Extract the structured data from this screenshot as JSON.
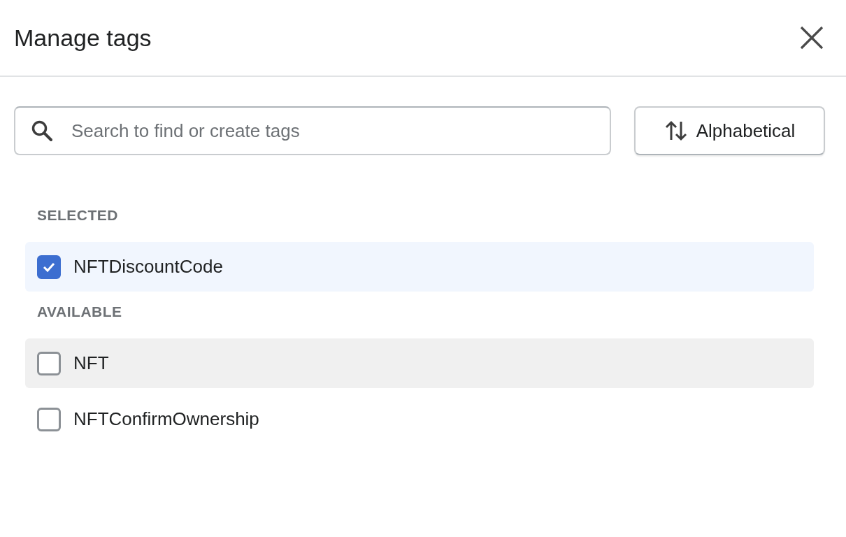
{
  "dialog": {
    "title": "Manage tags"
  },
  "search": {
    "placeholder": "Search to find or create tags"
  },
  "sort_button": {
    "label": "Alphabetical"
  },
  "sections": [
    {
      "heading": "SELECTED",
      "tags": [
        {
          "label": "NFTDiscountCode",
          "checked": true,
          "hovered": false
        }
      ]
    },
    {
      "heading": "AVAILABLE",
      "tags": [
        {
          "label": "NFT",
          "checked": false,
          "hovered": true
        },
        {
          "label": "NFTConfirmOwnership",
          "checked": false,
          "hovered": false
        }
      ]
    }
  ]
}
